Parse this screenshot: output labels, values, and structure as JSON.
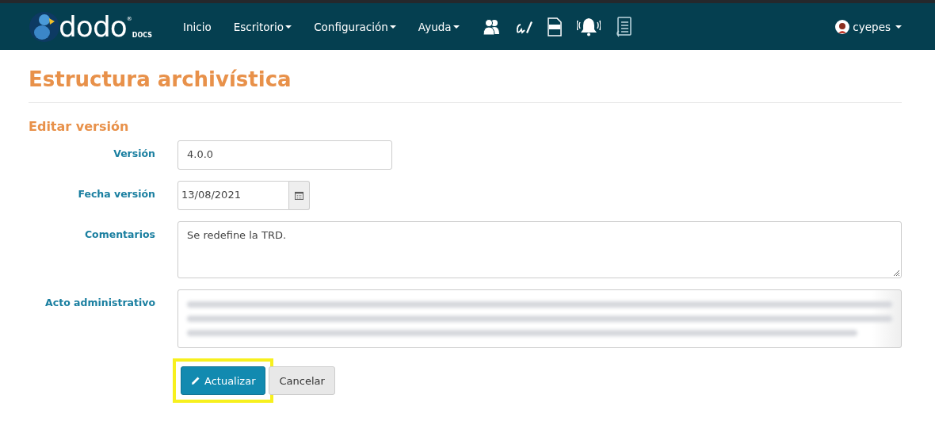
{
  "logo": {
    "text": "dodo",
    "registered": "®",
    "sub": "DOCS"
  },
  "nav": [
    {
      "label": "Inicio",
      "dropdown": false
    },
    {
      "label": "Escritorio",
      "dropdown": true
    },
    {
      "label": "Configuración",
      "dropdown": true
    },
    {
      "label": "Ayuda",
      "dropdown": true
    }
  ],
  "user": {
    "name": "cyepes",
    "dropdown": true
  },
  "page_title": "Estructura archivística",
  "section_title": "Editar versión",
  "fields": [
    {
      "kind": "text",
      "label": "Versión",
      "value": "4.0.0"
    },
    {
      "kind": "date",
      "label": "Fecha versión",
      "value": "13/08/2021"
    },
    {
      "kind": "textarea",
      "label": "Comentarios",
      "value": "Se redefine la TRD."
    },
    {
      "kind": "redacted",
      "label": "Acto administrativo"
    }
  ],
  "buttons": [
    {
      "kind": "primary",
      "label": "Actualizar",
      "highlighted": true
    },
    {
      "kind": "default",
      "label": "Cancelar",
      "highlighted": false
    }
  ]
}
